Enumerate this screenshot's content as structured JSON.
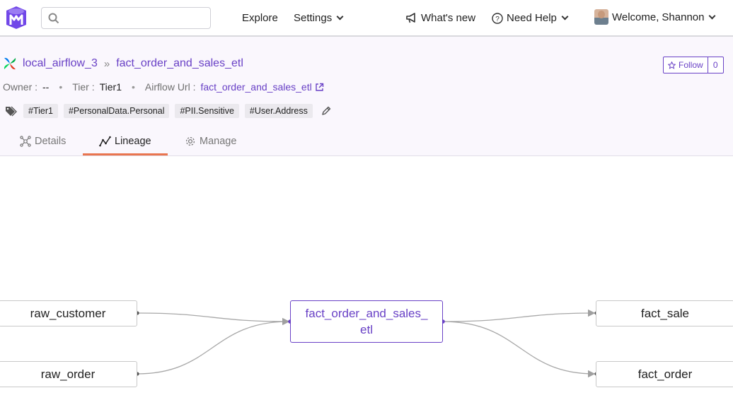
{
  "nav": {
    "search_placeholder": "",
    "explore": "Explore",
    "settings": "Settings",
    "whats_new": "What's new",
    "need_help": "Need Help",
    "welcome": "Welcome,",
    "user": "Shannon"
  },
  "header": {
    "breadcrumb": [
      "local_airflow_3",
      "fact_order_and_sales_etl"
    ],
    "follow_label": "Follow",
    "follow_count": "0",
    "owner_label": "Owner :",
    "owner_value": "--",
    "tier_label": "Tier :",
    "tier_value": "Tier1",
    "airflow_label": "Airflow Url :",
    "airflow_value": "fact_order_and_sales_etl",
    "tags": [
      "#Tier1",
      "#PersonalData.Personal",
      "#PII.Sensitive",
      "#User.Address"
    ]
  },
  "tabs": [
    {
      "label": "Details",
      "icon": "details-icon"
    },
    {
      "label": "Lineage",
      "icon": "lineage-icon",
      "active": true
    },
    {
      "label": "Manage",
      "icon": "manage-icon"
    }
  ],
  "lineage": {
    "upstream": [
      "raw_customer",
      "raw_order"
    ],
    "center": "fact_order_and_sales_etl",
    "center_lines": [
      "fact_order_and_sales_",
      "etl"
    ],
    "downstream": [
      "fact_sale",
      "fact_order"
    ]
  },
  "colors": {
    "accent": "#6941c6",
    "tab_underline": "#e9754f",
    "header_bg": "#faf7fd"
  }
}
